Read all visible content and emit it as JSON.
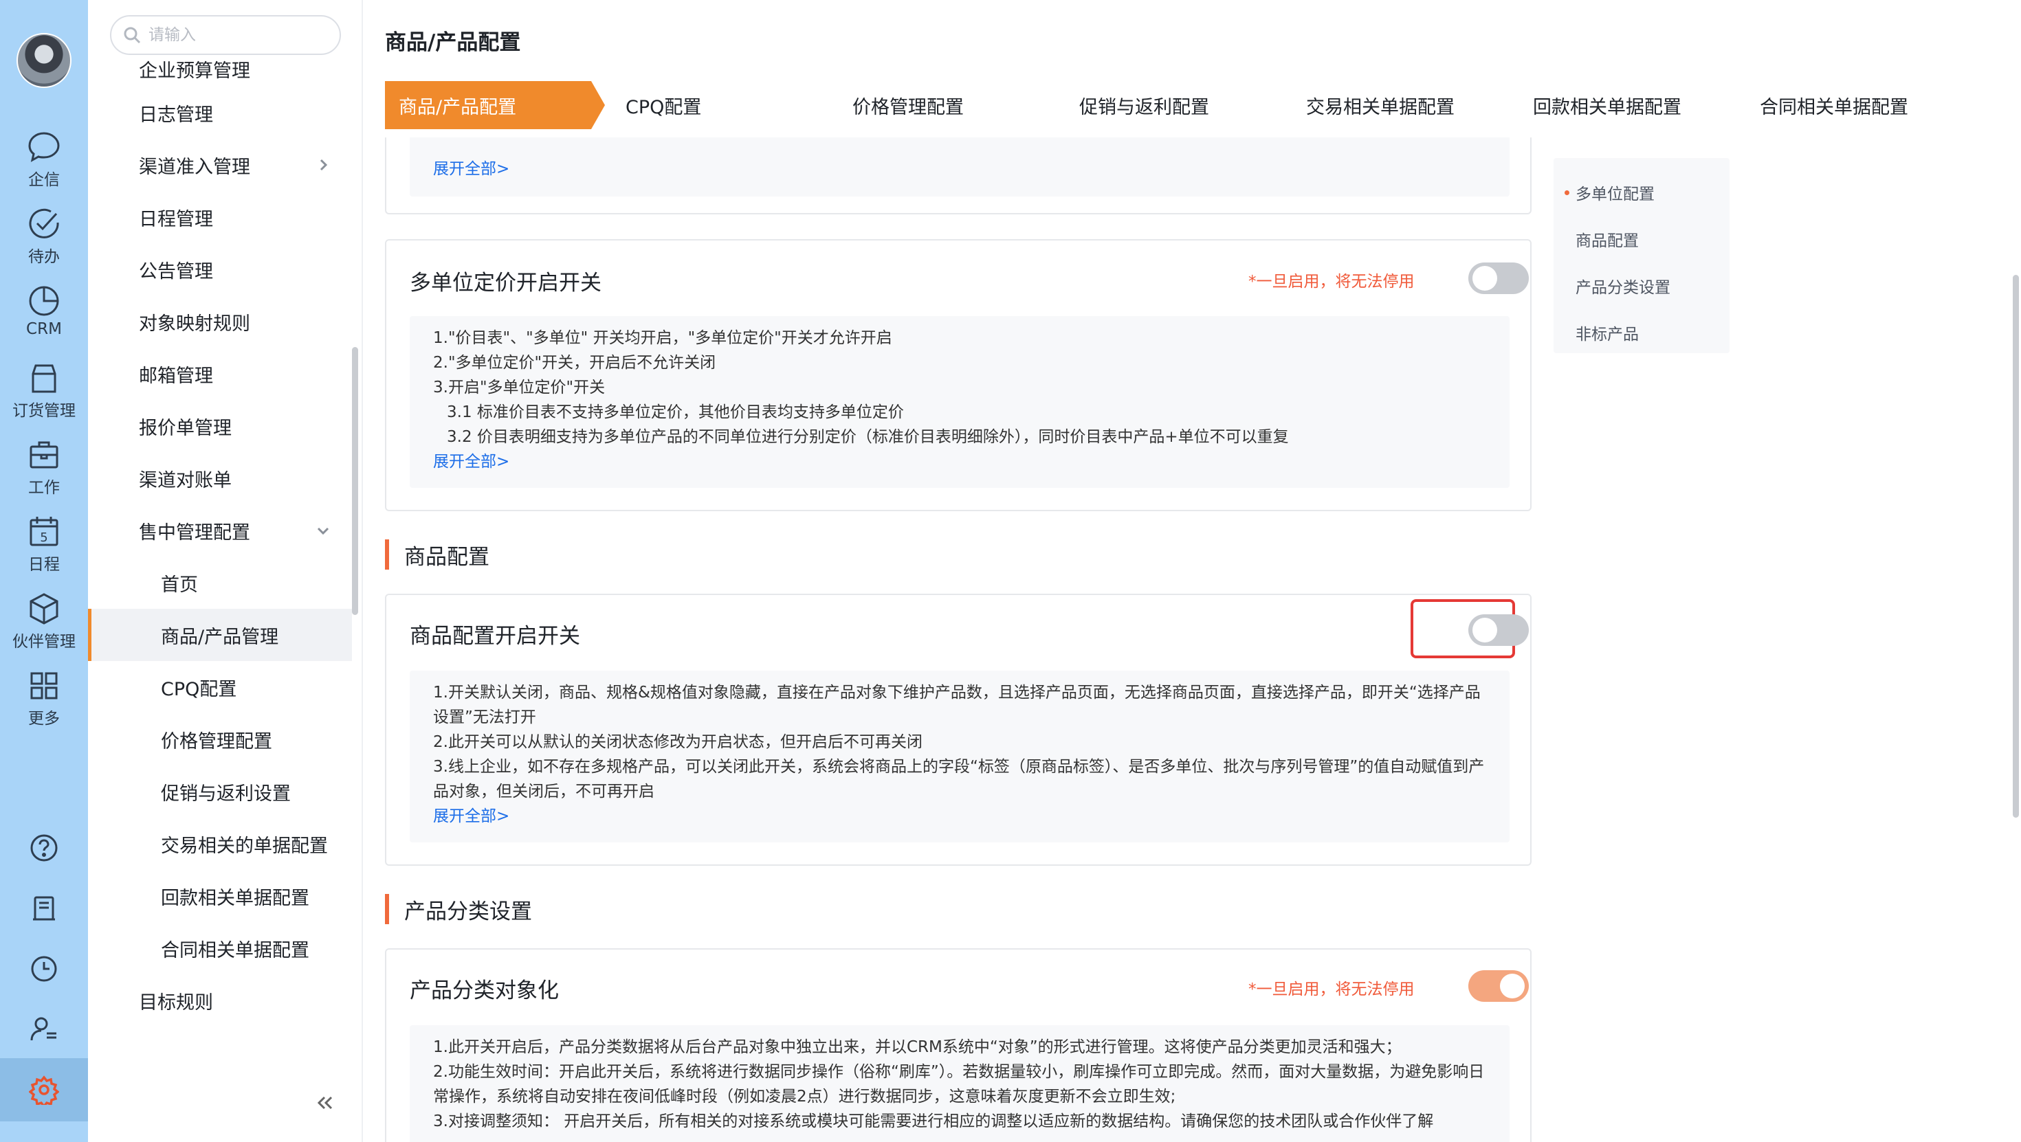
{
  "rail": {
    "items": [
      {
        "label": "企信",
        "icon": "chat-bubble-icon"
      },
      {
        "label": "待办",
        "icon": "check-circle-icon"
      },
      {
        "label": "CRM",
        "icon": "pie-chart-icon"
      },
      {
        "label": "订货管理",
        "icon": "shopping-bag-icon"
      },
      {
        "label": "工作",
        "icon": "briefcase-icon"
      },
      {
        "label": "日程",
        "icon": "calendar-icon",
        "badge": "5"
      },
      {
        "label": "伙伴管理",
        "icon": "cube-icon"
      },
      {
        "label": "更多",
        "icon": "grid-icon"
      }
    ],
    "tools": [
      "help-icon",
      "notebook-icon",
      "clock-icon",
      "user-settings-icon"
    ],
    "settings_icon": "gear-icon"
  },
  "menu": {
    "search_placeholder": "请输入",
    "items": [
      {
        "label": "企业预算管理"
      },
      {
        "label": "日志管理"
      },
      {
        "label": "渠道准入管理"
      },
      {
        "label": "日程管理"
      },
      {
        "label": "公告管理"
      },
      {
        "label": "对象映射规则"
      },
      {
        "label": "邮箱管理"
      },
      {
        "label": "报价单管理"
      },
      {
        "label": "渠道对账单"
      },
      {
        "label": "售中管理配置"
      },
      {
        "label": "首页"
      },
      {
        "label": "商品/产品管理"
      },
      {
        "label": "CPQ配置"
      },
      {
        "label": "价格管理配置"
      },
      {
        "label": "促销与返利设置"
      },
      {
        "label": "交易相关的单据配置"
      },
      {
        "label": "回款相关单据配置"
      },
      {
        "label": "合同相关单据配置"
      },
      {
        "label": "目标规则"
      }
    ]
  },
  "page": {
    "title": "商品/产品配置",
    "tabs": [
      "商品/产品配置",
      "CPQ配置",
      "价格管理配置",
      "促销与返利配置",
      "交易相关单据配置",
      "回款相关单据配置",
      "合同相关单据配置"
    ]
  },
  "top_card": {
    "more": "展开全部>"
  },
  "multi_unit": {
    "title": "多单位定价开启开关",
    "warning": "*一旦启用，将无法停用",
    "enabled": false,
    "lines": [
      "1.\"价目表\"、\"多单位\" 开关均开启，\"多单位定价\"开关才允许开启",
      "2.\"多单位定价\"开关，开启后不允许关闭",
      "3.开启\"多单位定价\"开关",
      "3.1 标准价目表不支持多单位定价，其他价目表均支持多单位定价",
      "3.2 价目表明细支持为多单位产品的不同单位进行分别定价（标准价目表明细除外），同时价目表中产品+单位不可以重复"
    ],
    "more": "展开全部>"
  },
  "product_section": {
    "heading": "商品配置"
  },
  "product_card": {
    "title": "商品配置开启开关",
    "enabled": false,
    "lines": [
      "1.开关默认关闭，商品、规格&规格值对象隐藏，直接在产品对象下维护产品数，且选择产品页面，无选择商品页面，直接选择产品，即开关“选择产品设置”无法打开",
      "2.此开关可以从默认的关闭状态修改为开启状态，但开启后不可再关闭",
      "3.线上企业，如不存在多规格产品，可以关闭此开关，系统会将商品上的字段“标签（原商品标签）、是否多单位、批次与序列号管理”的值自动赋值到产品对象，但关闭后，不可再开启"
    ],
    "more": "展开全部>"
  },
  "category_section": {
    "heading": "产品分类设置"
  },
  "category_card": {
    "title": "产品分类对象化",
    "warning": "*一旦启用，将无法停用",
    "enabled": true,
    "lines": [
      "1.此开关开启后，产品分类数据将从后台产品对象中独立出来，并以CRM系统中“对象”的形式进行管理。这将使产品分类更加灵活和强大；",
      "2.功能生效时间：开启此开关后，系统将进行数据同步操作（俗称“刷库”）。若数据量较小，刷库操作可立即完成。然而，面对大量数据，为避免影响日常操作，系统将自动安排在夜间低峰时段（例如凌晨2点）进行数据同步，这意味着灰度更新不会立即生效;",
      "3.对接调整须知：  开启开关后，所有相关的对接系统或模块可能需要进行相应的调整以适应新的数据结构。请确保您的技术团队或合作伙伴了解"
    ]
  },
  "anchor": {
    "items": [
      "多单位配置",
      "商品配置",
      "产品分类设置",
      "非标产品"
    ]
  },
  "colors": {
    "accent": "#f08a2c",
    "warning": "#f05a3a",
    "link": "#1d6ee8",
    "rail": "#a9d4f8",
    "highlight": "#e53935"
  }
}
